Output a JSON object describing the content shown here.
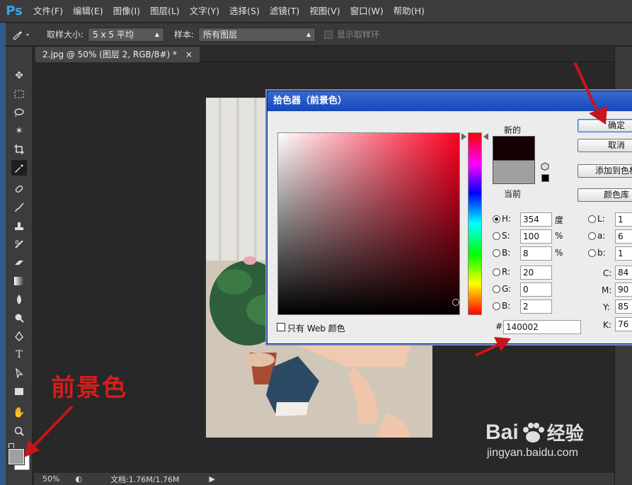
{
  "app": {
    "logo": "Ps"
  },
  "menu": [
    "文件(F)",
    "编辑(E)",
    "图像(I)",
    "图层(L)",
    "文字(Y)",
    "选择(S)",
    "滤镜(T)",
    "视图(V)",
    "窗口(W)",
    "帮助(H)"
  ],
  "options": {
    "sample_size_label": "取样大小:",
    "sample_size_value": "5 x 5 平均",
    "sample_label": "样本:",
    "sample_value": "所有图层",
    "show_ring_label": "显示取样环"
  },
  "document": {
    "tab_title": "2.jpg @ 50% (图层 2, RGB/8#) *",
    "close_symbol": "×"
  },
  "status": {
    "zoom": "50%",
    "doc_info": "文档:1.76M/1.76M"
  },
  "dialog": {
    "title": "拾色器（前景色）",
    "new_label": "新的",
    "current_label": "当前",
    "new_color": "#140002",
    "current_color": "#a0a0a0",
    "buttons": {
      "ok": "确定",
      "cancel": "取消",
      "add_swatch": "添加到色板",
      "color_library": "颜色库"
    },
    "hsb": [
      {
        "label": "H:",
        "value": "354",
        "unit": "度"
      },
      {
        "label": "S:",
        "value": "100",
        "unit": "%"
      },
      {
        "label": "B:",
        "value": "8",
        "unit": "%"
      }
    ],
    "rgb": [
      {
        "label": "R:",
        "value": "20"
      },
      {
        "label": "G:",
        "value": "0"
      },
      {
        "label": "B:",
        "value": "2"
      }
    ],
    "lab": [
      {
        "label": "L:",
        "value": "1"
      },
      {
        "label": "a:",
        "value": "6"
      },
      {
        "label": "b:",
        "value": "1"
      }
    ],
    "cmyk": [
      {
        "label": "C:",
        "value": "84"
      },
      {
        "label": "M:",
        "value": "90"
      },
      {
        "label": "Y:",
        "value": "85"
      },
      {
        "label": "K:",
        "value": "76"
      }
    ],
    "hex_label": "#",
    "hex_value": "140002",
    "web_only_label": "只有 Web 颜色"
  },
  "annotation": {
    "text": "前景色",
    "color": "#d51d1d"
  },
  "watermark": {
    "brand": "Bai",
    "brand2": "经验",
    "url": "jingyan.baidu.com"
  }
}
